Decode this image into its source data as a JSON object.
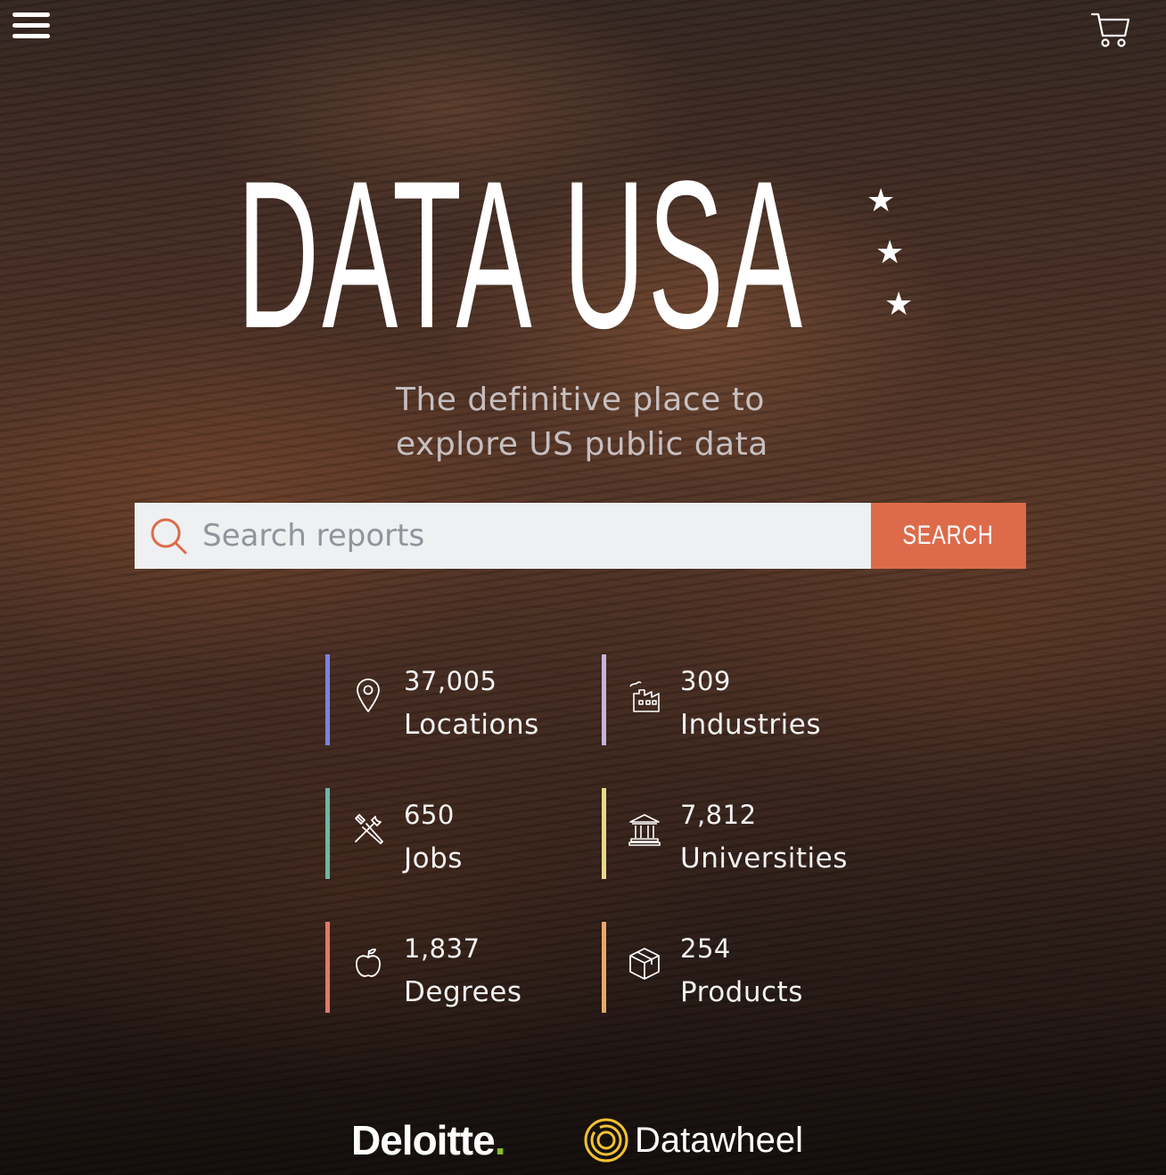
{
  "header": {
    "menu_icon": "hamburger-menu-icon",
    "cart_icon": "shopping-cart-icon"
  },
  "hero": {
    "logo_text": "DATA USA",
    "logo_star": "★",
    "tagline_line1": "The definitive place to",
    "tagline_line2": "explore US public data"
  },
  "search": {
    "placeholder": "Search reports",
    "button_label": "SEARCH",
    "icon": "search-icon"
  },
  "stats": [
    {
      "number": "37,005",
      "label": "Locations",
      "icon": "map-pin-icon",
      "color": "#7b83e0"
    },
    {
      "number": "309",
      "label": "Industries",
      "icon": "factory-icon",
      "color": "#c8b3dc"
    },
    {
      "number": "650",
      "label": "Jobs",
      "icon": "tools-icon",
      "color": "#6fb7a6"
    },
    {
      "number": "7,812",
      "label": "Universities",
      "icon": "university-building-icon",
      "color": "#e8d98a"
    },
    {
      "number": "1,837",
      "label": "Degrees",
      "icon": "apple-icon",
      "color": "#e07b66"
    },
    {
      "number": "254",
      "label": "Products",
      "icon": "package-box-icon",
      "color": "#e8a86a"
    }
  ],
  "partners": {
    "deloitte_name": "Deloitte",
    "deloitte_dot": ".",
    "datawheel_name": "Datawheel"
  },
  "colors": {
    "accent": "#dd6b4b",
    "deloitte_green": "#86bc25",
    "datawheel_gold": "#f2c230"
  }
}
